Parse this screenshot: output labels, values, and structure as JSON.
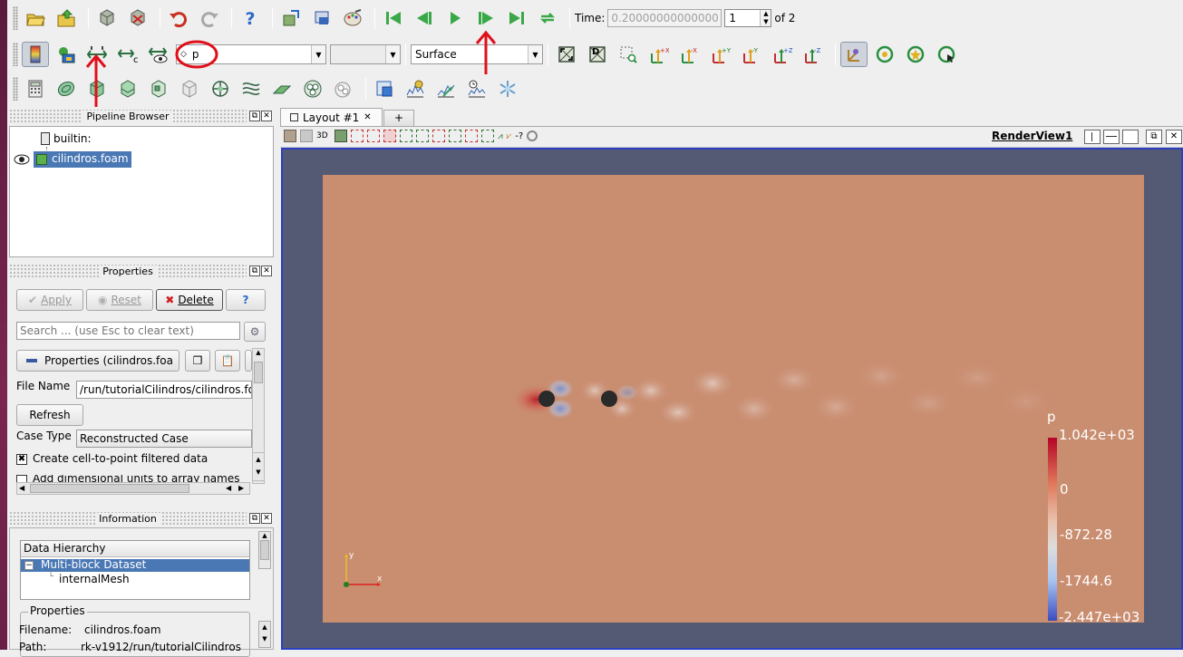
{
  "toolbar_top": {
    "time_label": "Time:",
    "time_value": "0.20000000000000",
    "step_value": "1",
    "step_of": "of 2"
  },
  "toolbar_second": {
    "array_selected": "p",
    "component_selected": "",
    "representation_selected": "Surface",
    "axis_buttons": [
      "+X",
      "-X",
      "+Y",
      "-Y",
      "+Z",
      "-Z"
    ]
  },
  "pipeline": {
    "title": "Pipeline Browser",
    "items": [
      "builtin:",
      "cilindros.foam"
    ]
  },
  "properties": {
    "title": "Properties",
    "apply": "Apply",
    "reset": "Reset",
    "delete": "Delete",
    "help": "?",
    "search_placeholder": "Search ... (use Esc to clear text)",
    "section_label": "Properties (cilindros.foa",
    "file_name_label": "File Name",
    "file_name_value": "/run/tutorialCilindros/cilindros.foam",
    "refresh": "Refresh",
    "case_type_label": "Case Type",
    "case_type_value": "Reconstructed Case",
    "checkbox1": "Create cell-to-point filtered data",
    "checkbox2": "Add dimensional units to array names"
  },
  "information": {
    "title": "Information",
    "data_hierarchy_header": "Data Hierarchy",
    "tree_root": "Multi-block Dataset",
    "tree_child": "internalMesh",
    "props_header": "Properties",
    "filename_label": "Filename:",
    "filename_value": "cilindros.foam",
    "path_label": "Path:",
    "path_value": "rk-v1912/run/tutorialCilindros"
  },
  "layout": {
    "tab_label": "Layout #1",
    "tab_close": "✕",
    "add_tab": "+",
    "view_name": "RenderView1",
    "tb_3d": "3D",
    "tb_q": "-?"
  },
  "legend": {
    "title": "p",
    "labels": [
      "1.042e+03",
      "0",
      "-872.28",
      "-1744.6",
      "-2.447e+03"
    ]
  },
  "axes": {
    "x": "x",
    "y": "y"
  },
  "colors": {
    "background": "#545a73",
    "field": "#c98d70",
    "annotation": "#e0101a",
    "selection": "#4a78b4"
  }
}
